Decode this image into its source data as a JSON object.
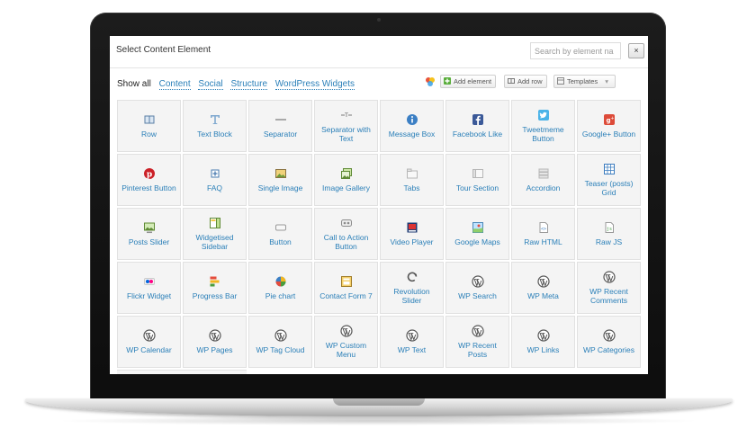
{
  "dialog": {
    "title": "Select Content Element",
    "search_placeholder": "Search by element na",
    "close_label": "×"
  },
  "filters": [
    "Show all",
    "Content",
    "Social",
    "Structure",
    "WordPress Widgets"
  ],
  "toolbar": {
    "add_element": "Add element",
    "add_row": "Add row",
    "templates": "Templates"
  },
  "elements": [
    {
      "label": "Row",
      "icon": "row-icon"
    },
    {
      "label": "Text Block",
      "icon": "text-block-icon"
    },
    {
      "label": "Separator",
      "icon": "separator-icon"
    },
    {
      "label": "Separator with Text",
      "icon": "separator-text-icon"
    },
    {
      "label": "Message Box",
      "icon": "info-icon"
    },
    {
      "label": "Facebook Like",
      "icon": "facebook-icon"
    },
    {
      "label": "Tweetmeme Button",
      "icon": "twitter-icon"
    },
    {
      "label": "Google+ Button",
      "icon": "google-plus-icon"
    },
    {
      "label": "Pinterest Button",
      "icon": "pinterest-icon"
    },
    {
      "label": "FAQ",
      "icon": "faq-icon"
    },
    {
      "label": "Single Image",
      "icon": "image-icon"
    },
    {
      "label": "Image Gallery",
      "icon": "gallery-icon"
    },
    {
      "label": "Tabs",
      "icon": "tabs-icon"
    },
    {
      "label": "Tour Section",
      "icon": "tour-icon"
    },
    {
      "label": "Accordion",
      "icon": "accordion-icon"
    },
    {
      "label": "Teaser (posts) Grid",
      "icon": "teaser-grid-icon"
    },
    {
      "label": "Posts Slider",
      "icon": "posts-slider-icon"
    },
    {
      "label": "Widgetised Sidebar",
      "icon": "sidebar-icon"
    },
    {
      "label": "Button",
      "icon": "button-icon"
    },
    {
      "label": "Call to Action Button",
      "icon": "cta-icon"
    },
    {
      "label": "Video Player",
      "icon": "video-icon"
    },
    {
      "label": "Google Maps",
      "icon": "map-icon"
    },
    {
      "label": "Raw HTML",
      "icon": "html-icon"
    },
    {
      "label": "Raw JS",
      "icon": "js-icon"
    },
    {
      "label": "Flickr Widget",
      "icon": "flickr-icon"
    },
    {
      "label": "Progress Bar",
      "icon": "progress-bar-icon"
    },
    {
      "label": "Pie chart",
      "icon": "pie-chart-icon"
    },
    {
      "label": "Contact Form 7",
      "icon": "contact-form-icon"
    },
    {
      "label": "Revolution Slider",
      "icon": "revolution-slider-icon"
    },
    {
      "label": "WP Search",
      "icon": "wordpress-icon"
    },
    {
      "label": "WP Meta",
      "icon": "wordpress-icon"
    },
    {
      "label": "WP Recent Comments",
      "icon": "wordpress-icon"
    },
    {
      "label": "WP Calendar",
      "icon": "wordpress-icon"
    },
    {
      "label": "WP Pages",
      "icon": "wordpress-icon"
    },
    {
      "label": "WP Tag Cloud",
      "icon": "wordpress-icon"
    },
    {
      "label": "WP Custom Menu",
      "icon": "wordpress-icon"
    },
    {
      "label": "WP Text",
      "icon": "wordpress-icon"
    },
    {
      "label": "WP Recent Posts",
      "icon": "wordpress-icon"
    },
    {
      "label": "WP Links",
      "icon": "wordpress-icon"
    },
    {
      "label": "WP Categories",
      "icon": "wordpress-icon"
    }
  ],
  "colors": {
    "link": "#2a7fb8",
    "cell_bg": "#f4f4f4",
    "cell_border": "#e1e1e1",
    "bezel": "#111111"
  }
}
